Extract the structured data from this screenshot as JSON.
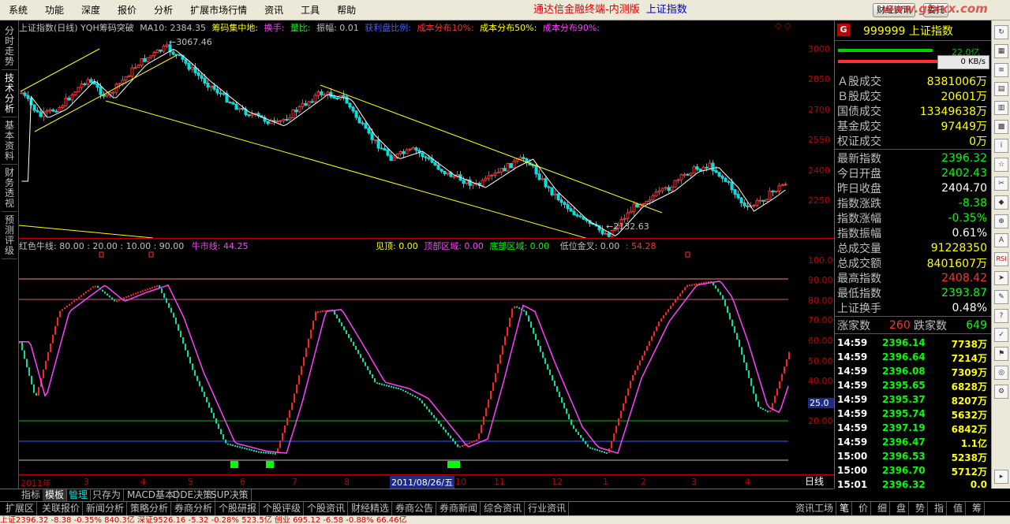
{
  "menu": [
    "系统",
    "功能",
    "深度",
    "报价",
    "分析",
    "扩展市场行情",
    "资讯",
    "工具",
    "帮助"
  ],
  "app_title": "通达信金融终端-内测版",
  "app_index": "上证指数",
  "top_buttons": [
    "财经资讯",
    "委托"
  ],
  "watermark": "www.gtxxx.com",
  "left_tabs": [
    "分时走势",
    "技术分析",
    "基本资料",
    "财务透视",
    "预测评级"
  ],
  "main_header": {
    "name": "上证指数(日线) YQH筹码突破",
    "ma10": "MA10: 2384.35",
    "items": [
      {
        "text": "筹码集中地:",
        "color": "#ffff00"
      },
      {
        "text": "换手:",
        "color": "#ff40ff"
      },
      {
        "text": "量比:",
        "color": "#00ff00"
      },
      {
        "text": "振幅: 0.01",
        "color": "#c0c0c0"
      },
      {
        "text": "获利盘比例:",
        "color": "#4060ff"
      },
      {
        "text": "成本分布10%:",
        "color": "#ff3030"
      },
      {
        "text": "成本分布50%:",
        "color": "#ffff00"
      },
      {
        "text": "成本分布90%:",
        "color": "#ff40ff"
      }
    ]
  },
  "main_annotations": {
    "high": "3067.46",
    "low": "2132.63"
  },
  "main_scale": [
    "3000",
    "2850",
    "2700",
    "2550",
    "2400",
    "2250"
  ],
  "osc_header": {
    "left": "红色牛线: 80.00 : 20.00 : 10.00 : 90.00",
    "bull": "牛市线: 44.25",
    "items": [
      {
        "text": "见顶: 0.00",
        "color": "#ffff00"
      },
      {
        "text": "顶部区域: 0.00",
        "color": "#ff40ff"
      },
      {
        "text": "底部区域: 0.00",
        "color": "#00ff00"
      },
      {
        "text": "低位金叉: 0.00",
        "color": "#c0c0c0"
      },
      {
        "text": ": 54.28",
        "color": "#ff3030"
      }
    ]
  },
  "osc_scale": [
    "100.0",
    "90.00",
    "80.00",
    "70.00",
    "60.00",
    "50.00",
    "40.00",
    "25.0",
    "20.00"
  ],
  "date_axis": [
    "2011年",
    "3",
    "4",
    "5",
    "6",
    "7",
    "8",
    "9",
    "10",
    "11",
    "12",
    "1",
    "2",
    "3",
    "4"
  ],
  "date_cursor": "2011/08/26/五",
  "right_panel": {
    "logo": "G",
    "code": "999999 上证指数",
    "bar_label": "22.0亿",
    "speed": "0 KB/s",
    "stats": [
      {
        "label": "Ａ股成交",
        "value": "8381006万",
        "color": "#ffff00"
      },
      {
        "label": "Ｂ股成交",
        "value": "20601万",
        "color": "#ffff00"
      },
      {
        "label": "国债成交",
        "value": "13349638万",
        "color": "#ffff00"
      },
      {
        "label": "基金成交",
        "value": "97449万",
        "color": "#ffff00"
      },
      {
        "label": "权证成交",
        "value": "0万",
        "color": "#ffff00"
      }
    ],
    "quotes": [
      {
        "label": "最新指数",
        "value": "2396.32",
        "color": "#00ff00"
      },
      {
        "label": "今日开盘",
        "value": "2402.43",
        "color": "#00ff00"
      },
      {
        "label": "昨日收盘",
        "value": "2404.70",
        "color": "#ffffff"
      },
      {
        "label": "指数涨跌",
        "value": "-8.38",
        "color": "#00ff00"
      },
      {
        "label": "指数涨幅",
        "value": "-0.35%",
        "color": "#00ff00"
      },
      {
        "label": "指数振幅",
        "value": "0.61%",
        "color": "#ffffff"
      },
      {
        "label": "总成交量",
        "value": "91228350",
        "color": "#ffff00"
      },
      {
        "label": "总成交额",
        "value": "8401607万",
        "color": "#ffff00"
      },
      {
        "label": "最高指数",
        "value": "2408.42",
        "color": "#ff3030"
      },
      {
        "label": "最低指数",
        "value": "2393.87",
        "color": "#00ff00"
      },
      {
        "label": "上证换手",
        "value": "0.48%",
        "color": "#ffffff"
      }
    ],
    "updown": {
      "up_label": "涨家数",
      "up": "260",
      "down_label": "跌家数",
      "down": "649"
    },
    "ticks": [
      {
        "time": "14:59",
        "price": "2396.14",
        "vol": "7738万"
      },
      {
        "time": "14:59",
        "price": "2396.64",
        "vol": "7214万"
      },
      {
        "time": "14:59",
        "price": "2396.08",
        "vol": "7309万"
      },
      {
        "time": "14:59",
        "price": "2395.65",
        "vol": "6828万"
      },
      {
        "time": "14:59",
        "price": "2395.37",
        "vol": "8207万"
      },
      {
        "time": "14:59",
        "price": "2395.74",
        "vol": "5632万"
      },
      {
        "time": "14:59",
        "price": "2397.19",
        "vol": "6842万"
      },
      {
        "time": "14:59",
        "price": "2396.47",
        "vol": "1.1亿"
      },
      {
        "time": "15:00",
        "price": "2396.53",
        "vol": "5238万"
      },
      {
        "time": "15:00",
        "price": "2396.70",
        "vol": "5712万"
      },
      {
        "time": "15:01",
        "price": "2396.32",
        "vol": "0.0"
      }
    ],
    "period": "日线"
  },
  "bottom_tabs": [
    "指标",
    "模板",
    "管理",
    "只存为",
    "MACD基本",
    "DDE决策",
    "SUP决策"
  ],
  "bottom_tabs2": [
    "扩展区",
    "关联报价",
    "新闻分析",
    "策略分析",
    "券商分析",
    "个股研报",
    "个股评级",
    "个股资讯",
    "财经精选",
    "券商公告",
    "券商新闻",
    "综合资讯",
    "行业资讯"
  ],
  "bottom_right_tabs": [
    "资讯工场",
    "笔",
    "价",
    "细",
    "盘",
    "势",
    "指",
    "值",
    "筹"
  ],
  "status_line": "上证2396.32  -8.38  -0.35%  840.3亿  深证9526.16  -5.32  -0.28%  523.5亿  创业  695.12  -6.58  -0.88%  66.46亿"
}
